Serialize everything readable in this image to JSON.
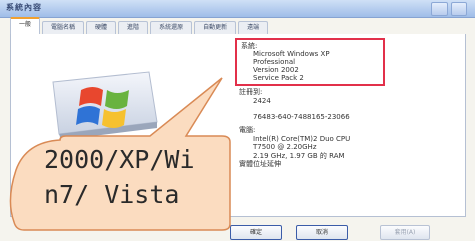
{
  "window": {
    "title": "系統內容",
    "controls": [
      "minimize",
      "close"
    ]
  },
  "tabs": [
    {
      "label": "一般",
      "active": true
    },
    {
      "label": "電腦名稱",
      "active": false
    },
    {
      "label": "硬體",
      "active": false
    },
    {
      "label": "進階",
      "active": false
    },
    {
      "label": "系統還原",
      "active": false
    },
    {
      "label": "自動更新",
      "active": false
    },
    {
      "label": "遠端",
      "active": false
    }
  ],
  "system": {
    "label": "系統:",
    "lines": [
      "Microsoft Windows XP",
      "Professional",
      "Version 2002",
      "Service Pack 2"
    ]
  },
  "registered": {
    "label": "註冊到:",
    "lines": [
      "2424",
      "",
      "76483-640-7488165-23066"
    ]
  },
  "computer": {
    "label": "電腦:",
    "lines": [
      "Intel(R) Core(TM)2 Duo CPU",
      "T7500 @ 2.20GHz",
      "2.19 GHz, 1.97 GB 的 RAM",
      "實體位址延伸"
    ]
  },
  "buttons": {
    "ok": "確定",
    "cancel": "取消",
    "apply": "套用(A)"
  },
  "callout": {
    "line1": "2000/XP/Wi",
    "line2": "n7/ Vista"
  },
  "colors": {
    "highlight_border": "#e2304a",
    "callout_fill": "#fbdcc0",
    "callout_border": "#d98a55",
    "background": "#f2d466"
  },
  "icons": {
    "logo": "windows-xp-logo-icon"
  }
}
